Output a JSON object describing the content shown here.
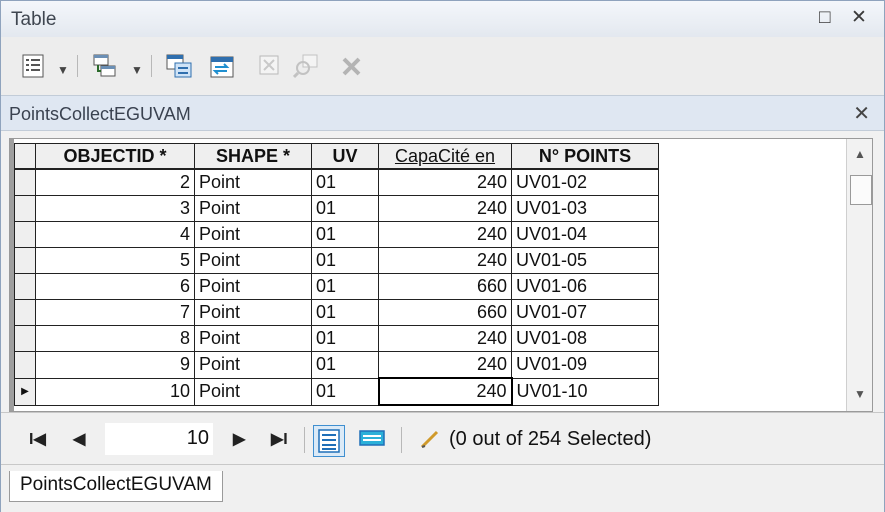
{
  "window": {
    "title": "Table",
    "restore_icon": "□",
    "close_icon": "✕"
  },
  "toolbar": {
    "buttons": [
      "table-options-icon",
      "related-tables-icon",
      "select-by-attributes-icon",
      "switch-selection-icon",
      "clear-selection-icon",
      "zoom-to-selected-icon",
      "delete-selected-icon"
    ]
  },
  "tab_header": {
    "title": "PointsCollectEGUVAM",
    "close_icon": "✕"
  },
  "grid": {
    "columns": [
      "OBJECTID *",
      "SHAPE *",
      "UV",
      "CapaCité en",
      "N° POINTS"
    ],
    "rows": [
      [
        "2",
        "Point",
        "01",
        "240",
        "UV01-02"
      ],
      [
        "3",
        "Point",
        "01",
        "240",
        "UV01-03"
      ],
      [
        "4",
        "Point",
        "01",
        "240",
        "UV01-04"
      ],
      [
        "5",
        "Point",
        "01",
        "240",
        "UV01-05"
      ],
      [
        "6",
        "Point",
        "01",
        "660",
        "UV01-06"
      ],
      [
        "7",
        "Point",
        "01",
        "660",
        "UV01-07"
      ],
      [
        "8",
        "Point",
        "01",
        "240",
        "UV01-08"
      ],
      [
        "9",
        "Point",
        "01",
        "240",
        "UV01-09"
      ],
      [
        "10",
        "Point",
        "01",
        "240",
        "UV01-10"
      ]
    ],
    "current_row_marker": "▶"
  },
  "navigation": {
    "first": "I◀",
    "prev": "◀",
    "current_record": "10",
    "next": "▶",
    "last": "▶I",
    "selection_text": "(0 out of 254 Selected)"
  },
  "bottom_tab": {
    "label": "PointsCollectEGUVAM"
  },
  "colors": {
    "accent": "#3f8fd0",
    "header_bg": "#dfe7f2"
  }
}
